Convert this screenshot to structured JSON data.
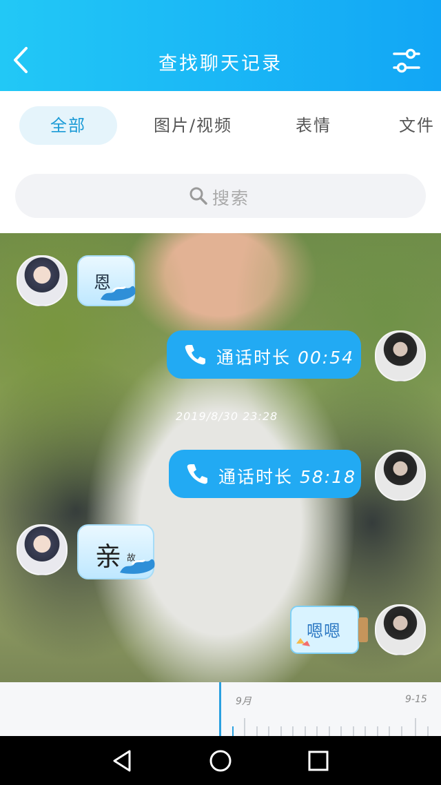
{
  "header": {
    "title": "查找聊天记录",
    "back_icon": "back-arrow-icon",
    "filter_icon": "filter-sliders-icon"
  },
  "tabs": [
    {
      "label": "全部",
      "active": true
    },
    {
      "label": "图片/视频",
      "active": false
    },
    {
      "label": "表情",
      "active": false
    },
    {
      "label": "文件",
      "active": false
    }
  ],
  "search": {
    "placeholder": "搜索",
    "icon": "search-icon"
  },
  "messages": [
    {
      "side": "left",
      "type": "sticker",
      "text": "恩"
    },
    {
      "side": "right",
      "type": "call",
      "label": "通话时长",
      "duration": "00:54"
    },
    {
      "type": "timestamp",
      "text": "2019/8/30 23:28"
    },
    {
      "side": "right",
      "type": "call",
      "label": "通话时长",
      "duration": "58:18"
    },
    {
      "side": "left",
      "type": "sticker",
      "text": "亲",
      "small_text": "故"
    },
    {
      "side": "right",
      "type": "sticker",
      "text": "嗯嗯"
    }
  ],
  "timeline": {
    "month_label": "9月",
    "date_label": "9-15"
  },
  "colors": {
    "header_start": "#22c8f6",
    "header_end": "#12a6f5",
    "accent": "#1a9ad6",
    "call_bubble": "#22aaf3"
  }
}
